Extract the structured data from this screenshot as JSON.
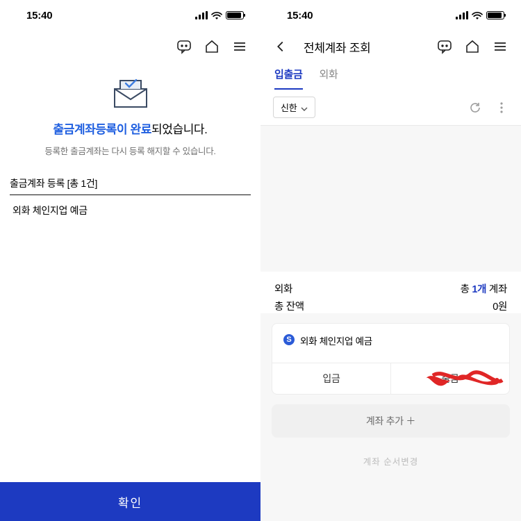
{
  "status": {
    "time": "15:40"
  },
  "left": {
    "headline_accent": "출금계좌등록이 완료",
    "headline_rest": "되었습니다.",
    "subline": "등록한 출금계좌는 다시 등록 해지할 수 있습니다.",
    "section_title": "출금계좌 등록 [총 1건]",
    "account_name": "외화 체인지업 예금",
    "confirm": "확인"
  },
  "right": {
    "header_title": "전체계좌 조회",
    "tabs": {
      "active": "입출금",
      "other": "외화"
    },
    "filter_bank": "신한",
    "summary": {
      "label_currency": "외화",
      "count_prefix": "총 ",
      "count_num": "1개",
      "count_suffix": " 계좌",
      "balance_label": "총 잔액",
      "balance_value": "0원"
    },
    "card": {
      "title": "외화 체인지업 예금",
      "deposit": "입금",
      "withdraw": "출금"
    },
    "add_account": "계좌 추가 ＋",
    "edit_order": "계좌 순서변경"
  }
}
